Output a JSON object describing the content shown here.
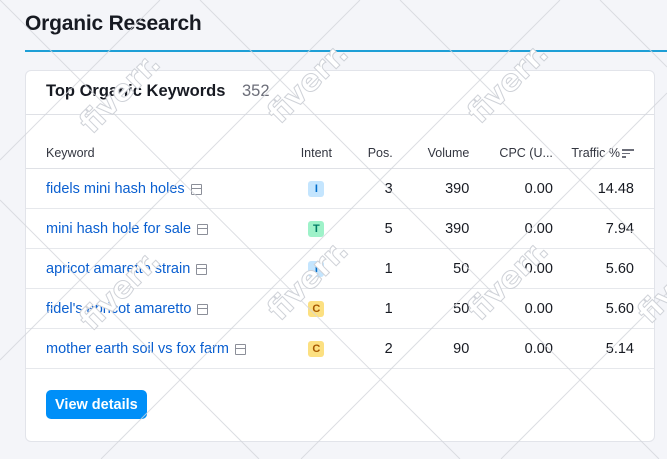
{
  "page": {
    "title": "Organic Research"
  },
  "card": {
    "title": "Top Organic Keywords",
    "count": "352",
    "view_details_label": "View details"
  },
  "table": {
    "columns": {
      "keyword": "Keyword",
      "intent": "Intent",
      "pos": "Pos.",
      "volume": "Volume",
      "cpc": "CPC (U...",
      "traffic": "Traffic %"
    },
    "rows": [
      {
        "keyword": "fidels mini hash holes",
        "intent": "I",
        "pos": "3",
        "volume": "390",
        "cpc": "0.00",
        "traffic": "14.48"
      },
      {
        "keyword": "mini hash hole for sale",
        "intent": "T",
        "pos": "5",
        "volume": "390",
        "cpc": "0.00",
        "traffic": "7.94"
      },
      {
        "keyword": "apricot amaretto strain",
        "intent": "I",
        "pos": "1",
        "volume": "50",
        "cpc": "0.00",
        "traffic": "5.60"
      },
      {
        "keyword": "fidel's apricot amaretto",
        "intent": "C",
        "pos": "1",
        "volume": "50",
        "cpc": "0.00",
        "traffic": "5.60"
      },
      {
        "keyword": "mother earth soil vs fox farm",
        "intent": "C",
        "pos": "2",
        "volume": "90",
        "cpc": "0.00",
        "traffic": "5.14"
      }
    ]
  },
  "icons": {
    "serp": "serp-features-icon",
    "sort": "sort-descending-icon"
  },
  "watermark": "fiverr.",
  "colors": {
    "accent_rule": "#1e9fd6",
    "link": "#0a5fd0",
    "button": "#008ff8",
    "intent_informational": "#c4e5fe",
    "intent_transactional": "#9ef2c9",
    "intent_commercial": "#fce081"
  }
}
